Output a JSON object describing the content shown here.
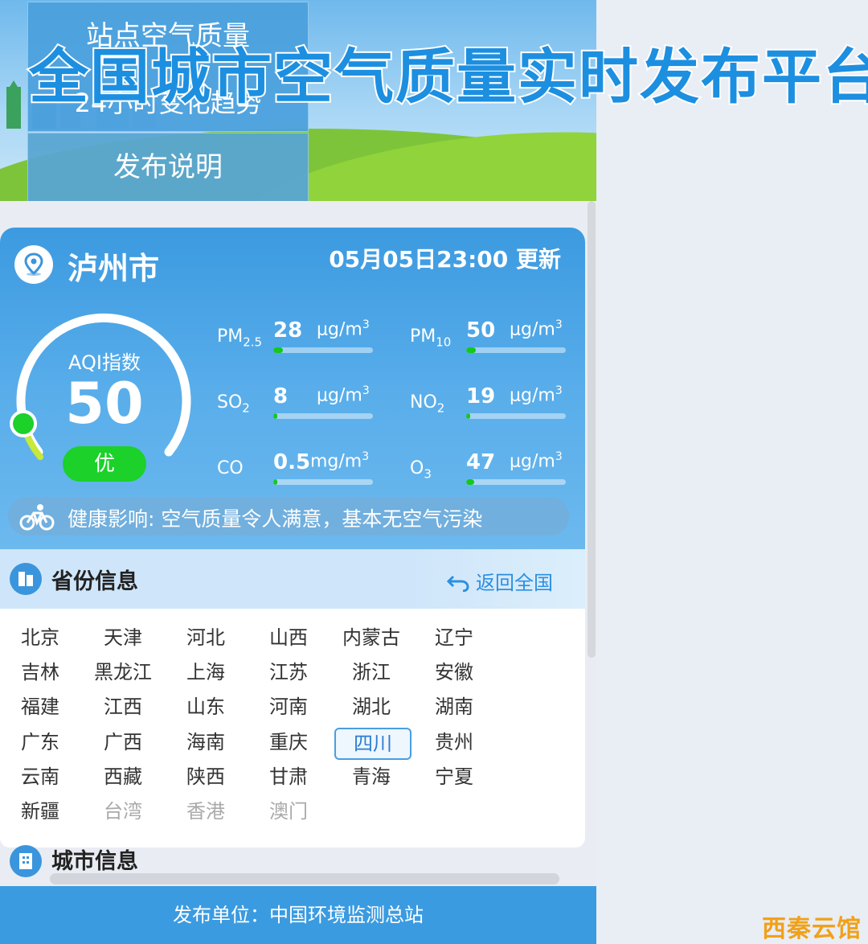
{
  "header": {
    "title": "全国城市空气质量实时发布平台",
    "tab_station_line1": "站点空气质量",
    "tab_station_line2": "24小时变化趋势",
    "tab_release": "发布说明"
  },
  "current": {
    "city": "泸州市",
    "updated": "05月05日23:00 更新",
    "aqi_label": "AQI指数",
    "aqi_value": "50",
    "aqi_fraction": 0.1,
    "level": "优",
    "level_color": "#1bd12a",
    "health": "健康影响: 空气质量令人满意，基本无空气污染"
  },
  "pollutants": [
    {
      "name": "PM",
      "sub": "2.5",
      "value": "28",
      "unit": "μg/m",
      "sup": "3",
      "fraction": 0.1
    },
    {
      "name": "PM",
      "sub": "10",
      "value": "50",
      "unit": "μg/m",
      "sup": "3",
      "fraction": 0.1
    },
    {
      "name": "SO",
      "sub": "2",
      "value": "8",
      "unit": "μg/m",
      "sup": "3",
      "fraction": 0.01
    },
    {
      "name": "NO",
      "sub": "2",
      "value": "19",
      "unit": "μg/m",
      "sup": "3",
      "fraction": 0.02
    },
    {
      "name": "CO",
      "sub": "",
      "value": "0.5",
      "unit": "mg/m",
      "sup": "3",
      "fraction": 0.01
    },
    {
      "name": "O",
      "sub": "3",
      "value": "47",
      "unit": "μg/m",
      "sup": "3",
      "fraction": 0.08
    }
  ],
  "province_section": {
    "title": "省份信息",
    "back": "返回全国",
    "items": [
      "北京",
      "天津",
      "河北",
      "山西",
      "内蒙古",
      "辽宁",
      "吉林",
      "黑龙江",
      "上海",
      "江苏",
      "浙江",
      "安徽",
      "福建",
      "江西",
      "山东",
      "河南",
      "湖北",
      "湖南",
      "广东",
      "广西",
      "海南",
      "重庆",
      "四川",
      "贵州",
      "云南",
      "西藏",
      "陕西",
      "甘肃",
      "青海",
      "宁夏",
      "新疆",
      "台湾",
      "香港",
      "澳门"
    ],
    "selected": "四川",
    "dimmed": [
      "台湾",
      "香港",
      "澳门"
    ]
  },
  "city_section": {
    "title": "城市信息"
  },
  "footer": {
    "text": "发布单位：中国环境监测总站"
  },
  "watermark": "西秦云馆",
  "colors": {
    "accent": "#3b9be0",
    "good": "#1bd12a"
  },
  "icons": [
    "location-pin-icon",
    "bicycle-icon",
    "buildings-icon",
    "back-arrow-icon",
    "city-building-icon"
  ]
}
